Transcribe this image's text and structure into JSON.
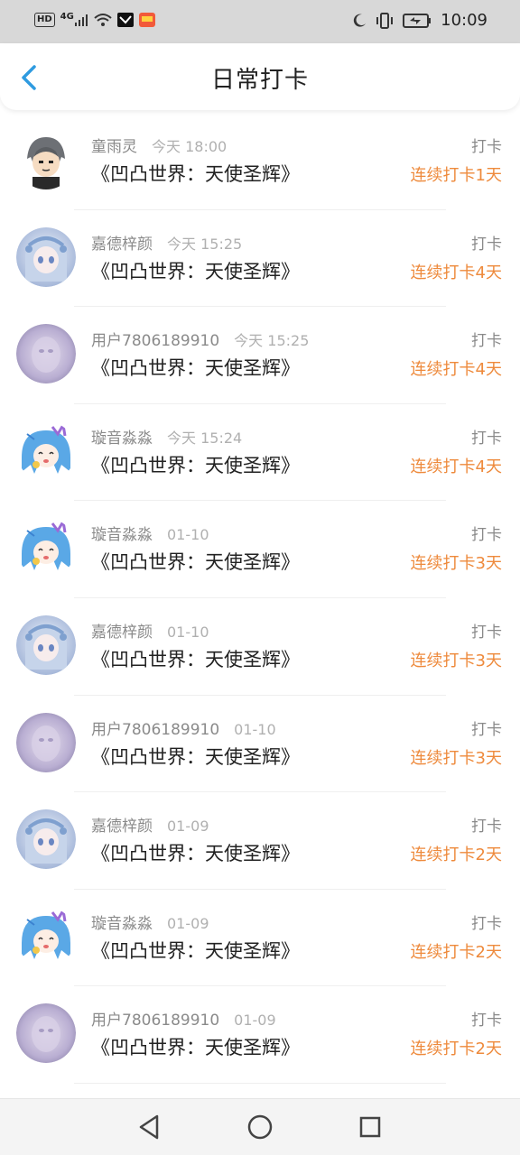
{
  "status_bar": {
    "network_badge": "HD",
    "network_type": "4G",
    "time": "10:09"
  },
  "header": {
    "title": "日常打卡"
  },
  "records": [
    {
      "user": "童雨灵",
      "time": "今天 18:00",
      "action": "打卡",
      "book": "《凹凸世界：天使圣辉》",
      "streak": "连续打卡1天",
      "avatar": "cartoon-boy"
    },
    {
      "user": "嘉德梓颜",
      "time": "今天 15:25",
      "action": "打卡",
      "book": "《凹凸世界：天使圣辉》",
      "streak": "连续打卡4天",
      "avatar": "pale-girl"
    },
    {
      "user": "用户7806189910",
      "time": "今天 15:25",
      "action": "打卡",
      "book": "《凹凸世界：天使圣辉》",
      "streak": "连续打卡4天",
      "avatar": "lavender-blur"
    },
    {
      "user": "璇音淼淼",
      "time": "今天 15:24",
      "action": "打卡",
      "book": "《凹凸世界：天使圣辉》",
      "streak": "连续打卡4天",
      "avatar": "blue-hair-girl"
    },
    {
      "user": "璇音淼淼",
      "time": "01-10",
      "action": "打卡",
      "book": "《凹凸世界：天使圣辉》",
      "streak": "连续打卡3天",
      "avatar": "blue-hair-girl"
    },
    {
      "user": "嘉德梓颜",
      "time": "01-10",
      "action": "打卡",
      "book": "《凹凸世界：天使圣辉》",
      "streak": "连续打卡3天",
      "avatar": "pale-girl"
    },
    {
      "user": "用户7806189910",
      "time": "01-10",
      "action": "打卡",
      "book": "《凹凸世界：天使圣辉》",
      "streak": "连续打卡3天",
      "avatar": "lavender-blur"
    },
    {
      "user": "嘉德梓颜",
      "time": "01-09",
      "action": "打卡",
      "book": "《凹凸世界：天使圣辉》",
      "streak": "连续打卡2天",
      "avatar": "pale-girl"
    },
    {
      "user": "璇音淼淼",
      "time": "01-09",
      "action": "打卡",
      "book": "《凹凸世界：天使圣辉》",
      "streak": "连续打卡2天",
      "avatar": "blue-hair-girl"
    },
    {
      "user": "用户7806189910",
      "time": "01-09",
      "action": "打卡",
      "book": "《凹凸世界：天使圣辉》",
      "streak": "连续打卡2天",
      "avatar": "lavender-blur"
    }
  ],
  "colors": {
    "accent_blue": "#2f9be0",
    "streak_orange": "#ee8a3c",
    "status_bar_bg": "#d8d8d8"
  }
}
